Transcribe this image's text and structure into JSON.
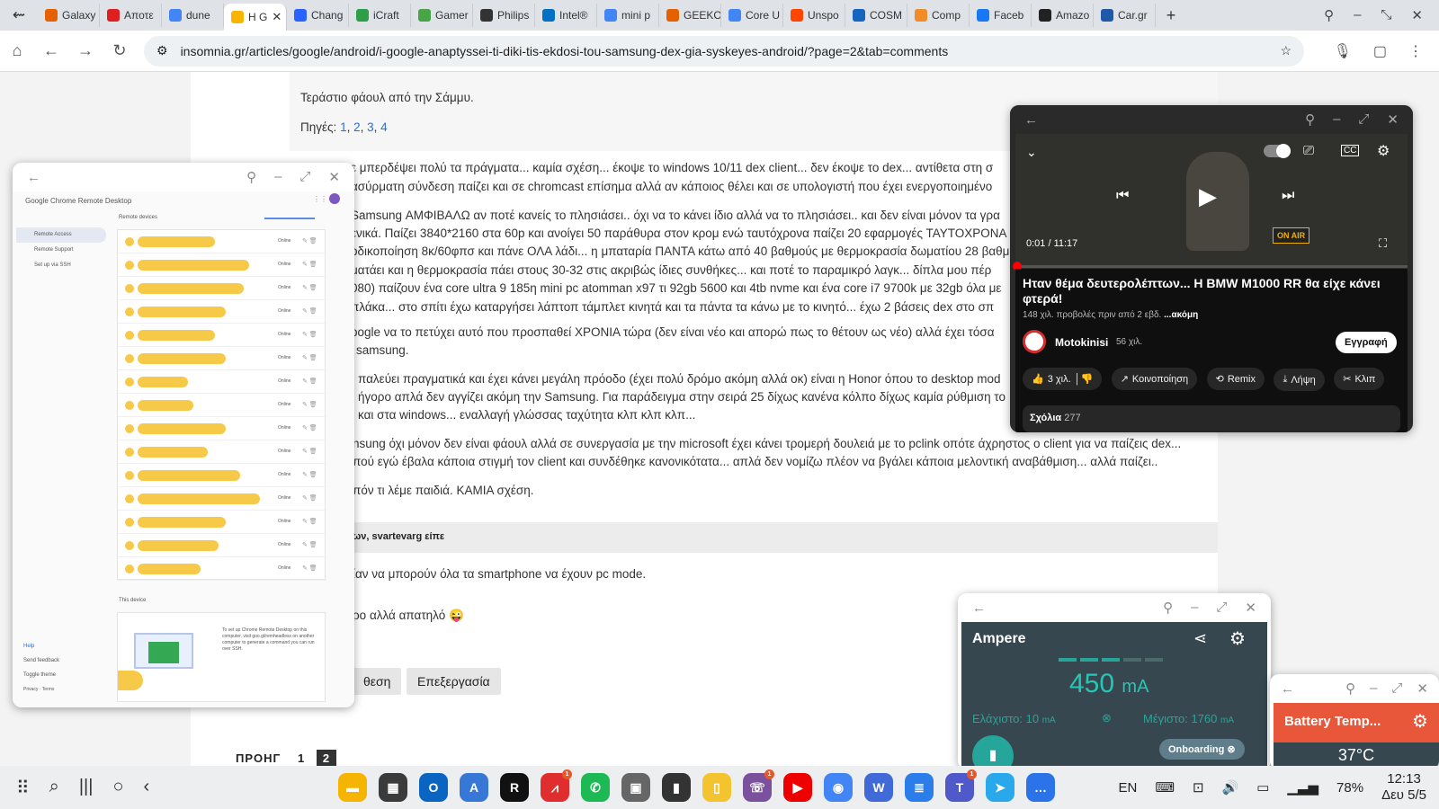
{
  "browser": {
    "tabs": [
      {
        "title": "Galaxy",
        "icon": "firefox-icon",
        "color": "#e66000"
      },
      {
        "title": "Αποτε",
        "icon": "record-icon",
        "color": "#e02020"
      },
      {
        "title": "dune",
        "icon": "google-icon",
        "color": "#4285f4"
      },
      {
        "title": "Η G",
        "icon": "insomnia-icon",
        "color": "#f7b500",
        "active": true
      },
      {
        "title": "Chang",
        "icon": "s-icon",
        "color": "#2962ff"
      },
      {
        "title": "iCraft",
        "icon": "leaf-icon",
        "color": "#2e9e48"
      },
      {
        "title": "Gamer",
        "icon": "gamer-icon",
        "color": "#47a447"
      },
      {
        "title": "Philips",
        "icon": "philips-icon",
        "color": "#333"
      },
      {
        "title": "Intel®",
        "icon": "intel-icon",
        "color": "#0071c5"
      },
      {
        "title": "mini p",
        "icon": "google-icon",
        "color": "#4285f4"
      },
      {
        "title": "GEEKO",
        "icon": "geeko-icon",
        "color": "#e66000"
      },
      {
        "title": "Core U",
        "icon": "google-icon",
        "color": "#4285f4"
      },
      {
        "title": "Unspo",
        "icon": "reddit-icon",
        "color": "#ff4500"
      },
      {
        "title": "COSM",
        "icon": "c-icon",
        "color": "#1565c0"
      },
      {
        "title": "Comp",
        "icon": "comp-icon",
        "color": "#f28c28"
      },
      {
        "title": "Faceb",
        "icon": "facebook-icon",
        "color": "#1877f2"
      },
      {
        "title": "Amazo",
        "icon": "amazon-icon",
        "color": "#222"
      },
      {
        "title": "Car.gr",
        "icon": "car-icon",
        "color": "#1e5aa8"
      }
    ],
    "url": "insomnia.gr/articles/google/android/i-google-anaptyssei-ti-diki-tis-ekdosi-tou-samsung-dex-gia-syskeyes-android/?page=2&tab=comments"
  },
  "article": {
    "quote_line": "Τεράστιο φάουλ από την Σάμμυ.",
    "sources_label": "Πηγές:",
    "sources": [
      "1",
      "2",
      "3",
      "4"
    ],
    "lines": [
      "ε μπερδέψει πολύ τα πράγματα... καμία σχέση... έκοψε το windows 10/11 dex client... δεν έκοψε το dex... αντίθετα στη σ",
      "ασύρματη σύνδεση παίζει και σε chromcast επίσημα αλλά αν κάποιος θέλει και σε υπολογιστή που έχει ενεργοποιημένο",
      "Samsung ΑΜΦΙΒΑΛΩ αν ποτέ κανείς το πλησιάσει.. όχι να το κάνει ίδιο αλλά να το πλησιάσει.. και δεν είναι μόνον τα γρα",
      "ενικά. Παίζει 3840*2160 στα 60p και ανοίγει 50 παράθυρα στον κρομ ενώ ταυτόχρονα παίζει 20 εφαρμογές ΤΑΥΤΟΧΡΟΝΑ",
      "οδικοποίηση 8κ/60φπσ και πάνε ΟΛΑ λάδι... η μπαταρία ΠΑΝΤΑ κάτω από 40 βαθμούς με θερμοκρασία δωματίου 28 βαθμ",
      "ματάει και η θερμοκρασία πάει στους 30-32 στις ακριβώς ίδιες συνθήκες... και ποτέ το παραμικρό λαγκ... δίπλα μου πέρ",
      "080) παίζουν ένα core ultra 9 185η mini pc atomman x97 τι 92gb 5600 και 4tb nvme και ένα core i7 9700k με 32gb όλα με",
      "πλάκα... στο σπίτι έχω καταργήσει λάπτοπ τάμπλετ κινητά και τα πάντα τα κάνω με το κινητό... έχω 2 βάσεις dex στο σπ",
      "oogle να το πετύχει αυτό που προσπαθεί ΧΡΟΝΙΑ τώρα (δεν είναι νέο και απορώ πως το θέτουν ως νέο) αλλά έχει τόσα",
      "samsung.",
      "παλεύει πραγματικά και έχει κάνει μεγάλη πρόοδο (έχει πολύ δρόμο ακόμη αλλά οκ) είναι η Honor όπου το desktop mod",
      "ήγορο απλά δεν αγγίζει ακόμη την Samsung. Για παράδειγμα στην σειρά 25 δίχως κανένα κόλπο δίχως καμία ρύθμιση το",
      "και στα windows... εναλλαγή γλώσσας ταχύτητα κλπ κλπ κλπ...",
      "nsung όχι μόνον δεν είναι φάουλ αλλά σε συνεργασία με την microsoft έχει κάνει τρομερή δουλειά με το pclink οπότε άχρηστος ο client για να παίζεις dex...",
      "πού εγώ έβαλα κάποια στιγμή τον client και συνδέθηκε κανονικότατα... απλά δεν νομίζω πλέον να βγάλει κάποια μελοντική αναβάθμιση... αλλά παίζει..",
      "πόν τι λέμε παιδιά. ΚΑΜΙΑ σχέση."
    ],
    "reply_header": "ων, svartevarg είπε",
    "reply_text": "ίαν να μπορούν όλα τα smartphone να έχουν pc mode.",
    "reply_text2": "ρο αλλά απατηλό 😜",
    "btn_left": "θεση",
    "btn_edit": "Επεξεργασία",
    "pager_prev": "ΠΡΟΗΓ",
    "pager_1": "1",
    "pager_2": "2"
  },
  "remote_desktop": {
    "brand": "Google Chrome Remote Desktop",
    "section": "Remote devices",
    "nav": [
      "Remote Access",
      "Remote Support",
      "Set up via SSH"
    ],
    "status": "Online",
    "rows": [
      86,
      124,
      118,
      98,
      86,
      98,
      56,
      62,
      98,
      78,
      114,
      136,
      98,
      90,
      70
    ],
    "this_device": "This device",
    "help": [
      "Help",
      "Send feedback",
      "Toggle theme",
      "Privacy · Terms"
    ],
    "setup_text": "To set up Chrome Remote Desktop on this computer, visit goo.gl/remheadless on another computer to generate a command you can run over SSH."
  },
  "youtube": {
    "time": "0:01 / 11:17",
    "title": "Ηταν θέμα δευτερολέπτων... Η BMW M1000 RR θα είχε κάνει φτερά!",
    "meta": "148 χιλ. προβολές  πριν από 2 εβδ.",
    "more": "...ακόμη",
    "channel": "Motokinisi",
    "subs": "56 χιλ.",
    "subscribe": "Εγγραφή",
    "likes": "3 χιλ.",
    "share": "Κοινοποίηση",
    "remix": "Remix",
    "download": "Λήψη",
    "clip": "Κλιπ",
    "comments": "Σχόλια",
    "comments_count": "277",
    "on_air": "ON AIR"
  },
  "ampere": {
    "title": "Ampere",
    "value": "450",
    "unit": "mA",
    "min": "Ελάχιστο: 10",
    "max": "Μέγιστο: 1760",
    "min_unit": "mA",
    "max_unit": "mA",
    "onboarding": "Onboarding",
    "accent": "#26a69a"
  },
  "battery": {
    "title": "Battery Temp...",
    "value": "37°C"
  },
  "taskbar": {
    "lang": "EN",
    "battery": "78%",
    "time": "12:13",
    "date": "Δευ 5/5"
  }
}
